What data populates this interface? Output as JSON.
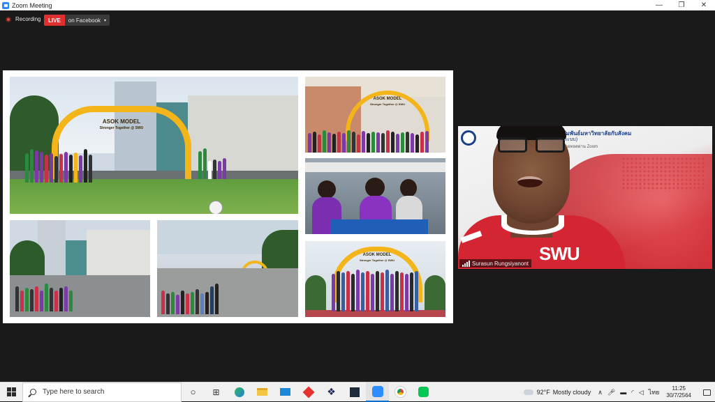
{
  "window": {
    "title": "Zoom Meeting",
    "controls": [
      "—",
      "❐",
      "✕"
    ]
  },
  "meeting": {
    "recording_label": "Recording",
    "live_badge": "LIVE",
    "live_destination": "on Facebook",
    "caret": "▾"
  },
  "shared_screen": {
    "photos": [
      {
        "arch_title": "ASOK MODEL",
        "arch_subtitle": "Stronger Together @ SWU"
      },
      {
        "arch_title": "ASOK MODEL",
        "arch_subtitle": "Stronger Together @ SWU"
      },
      {
        "arch_title": "ASOK MODEL",
        "arch_subtitle": "Stronger Together @ SWU"
      }
    ]
  },
  "participant_video": {
    "name": "Surasun Rungsiyanont",
    "slide_title": "กิจสัมพันธ์มหาวิทยาลัยกับสังคม",
    "slide_sub": "(ระบบ)",
    "slide_sub2": "ถ่ายทอดผ่าน Zoom",
    "jacket_text": "SWU"
  },
  "taskbar": {
    "search_placeholder": "Type here to search",
    "icons": [
      "task-view-icon",
      "widgets-icon",
      "edge-icon",
      "file-explorer-icon",
      "mail-icon",
      "app-red-icon",
      "dropbox-icon",
      "terminal-icon",
      "zoom-icon",
      "chrome-icon",
      "line-icon"
    ],
    "weather_temp": "92°F",
    "weather_desc": "Mostly cloudy",
    "tray_up": "∧",
    "lang": "ไทย",
    "clock_time": "11:25",
    "clock_date": "30/7/2564"
  },
  "colors": {
    "live_red": "#e02f2f",
    "zoom_blue": "#2d8cff",
    "arch_yellow": "#f3b519",
    "swu_red": "#d42533"
  }
}
